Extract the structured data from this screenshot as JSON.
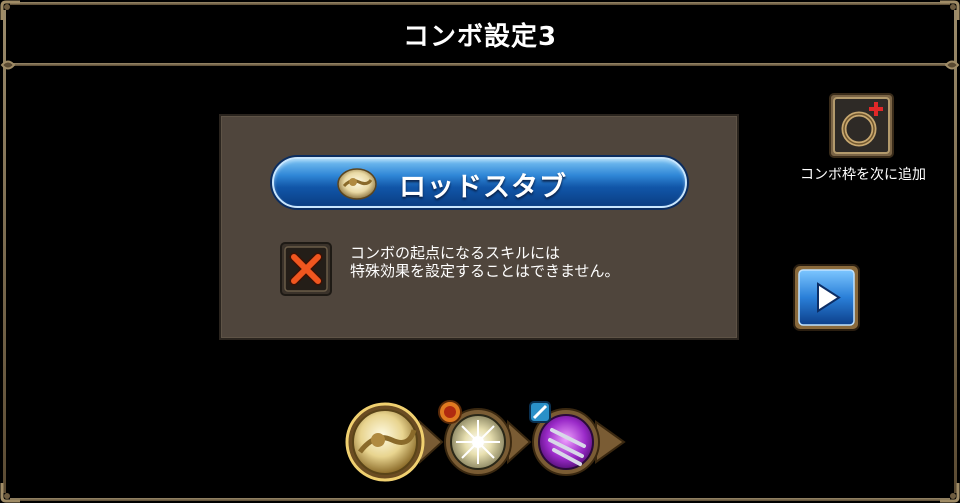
{
  "header": {
    "title": "コンボ設定3"
  },
  "panel": {
    "skill_button_label": "ロッドスタブ",
    "message_line1": "コンボの起点になるスキルには",
    "message_line2": "特殊効果を設定することはできません。"
  },
  "side": {
    "add_combo_label": "コンボ枠を次に追加"
  },
  "combo_chain": {
    "skills": [
      {
        "icon": "rod-stab-icon",
        "selected": true
      },
      {
        "icon": "light-burst-icon",
        "badge": "special-effect-badge-icon"
      },
      {
        "icon": "triple-blade-icon",
        "badge": "weapon-badge-icon"
      }
    ]
  },
  "colors": {
    "background": "#000000",
    "panel": "#4f453c",
    "frame": "#9a8a6a",
    "skill_button": "#1a6cc4",
    "play_button": "#2a7fd8",
    "close_x": "#e05020"
  }
}
